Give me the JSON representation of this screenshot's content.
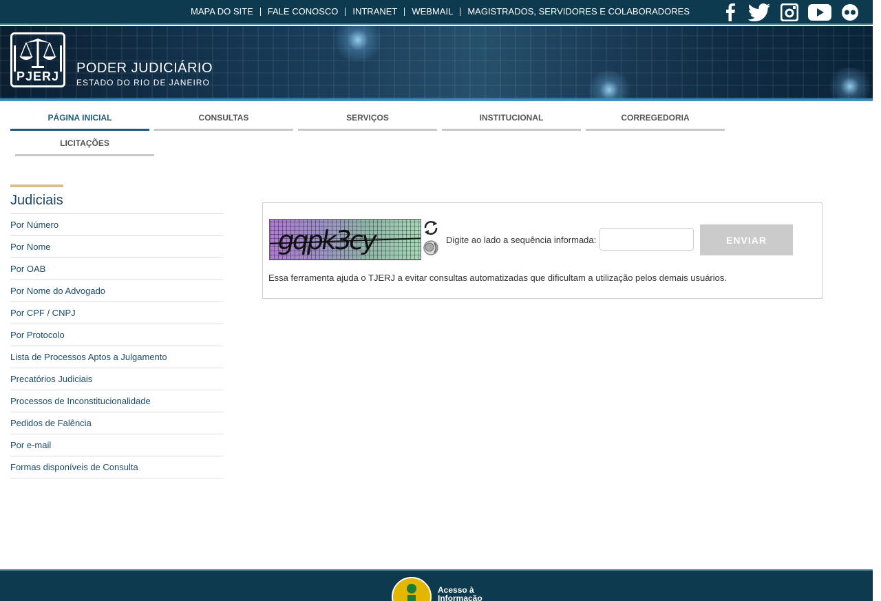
{
  "topbar": {
    "links": [
      "MAPA DO SITE",
      "FALE CONOSCO",
      "INTRANET",
      "WEBMAIL",
      "MAGISTRADOS, SERVIDORES E COLABORADORES"
    ],
    "social_icons": [
      "facebook-icon",
      "twitter-icon",
      "instagram-icon",
      "youtube-icon",
      "flickr-icon"
    ]
  },
  "header": {
    "logo_text": "PJERJ",
    "title": "PODER JUDICIÁRIO",
    "subtitle": "ESTADO DO RIO DE JANEIRO"
  },
  "nav": {
    "items": [
      "PÁGINA INICIAL",
      "CONSULTAS",
      "SERVIÇOS",
      "INSTITUCIONAL",
      "CORREGEDORIA",
      "LICITAÇÕES"
    ],
    "active": "PÁGINA INICIAL"
  },
  "sidebar": {
    "title": "Judiciais",
    "items": [
      "Por Número",
      "Por Nome",
      "Por OAB",
      "Por Nome do Advogado",
      "Por CPF / CNPJ",
      "Por Protocolo",
      "Lista de Processos Aptos a Julgamento",
      "Precatórios Judiciais",
      "Processos de Inconstitucionalidade",
      "Pedidos de Falência",
      "Por e-mail",
      "Formas disponíveis de Consulta"
    ]
  },
  "captcha": {
    "image_text": "gqpk3cy",
    "label": "Digite ao lado a sequência informada:",
    "input_value": "",
    "submit_label": "ENVIAR",
    "note": "Essa ferramenta ajuda o TJERJ a evitar consultas automatizadas que dificultam a utilização pelos demais usuários."
  },
  "footer": {
    "badge_text_1": "Acesso à",
    "badge_text_2": "Informação"
  },
  "colors": {
    "topbar_bg": "#0e3a4f",
    "accent_blue": "#1c5a78",
    "stripe_blue": "#3a8fbf",
    "sidebar_accent": "#d9c08a",
    "button_gray": "#cbcbcb"
  }
}
